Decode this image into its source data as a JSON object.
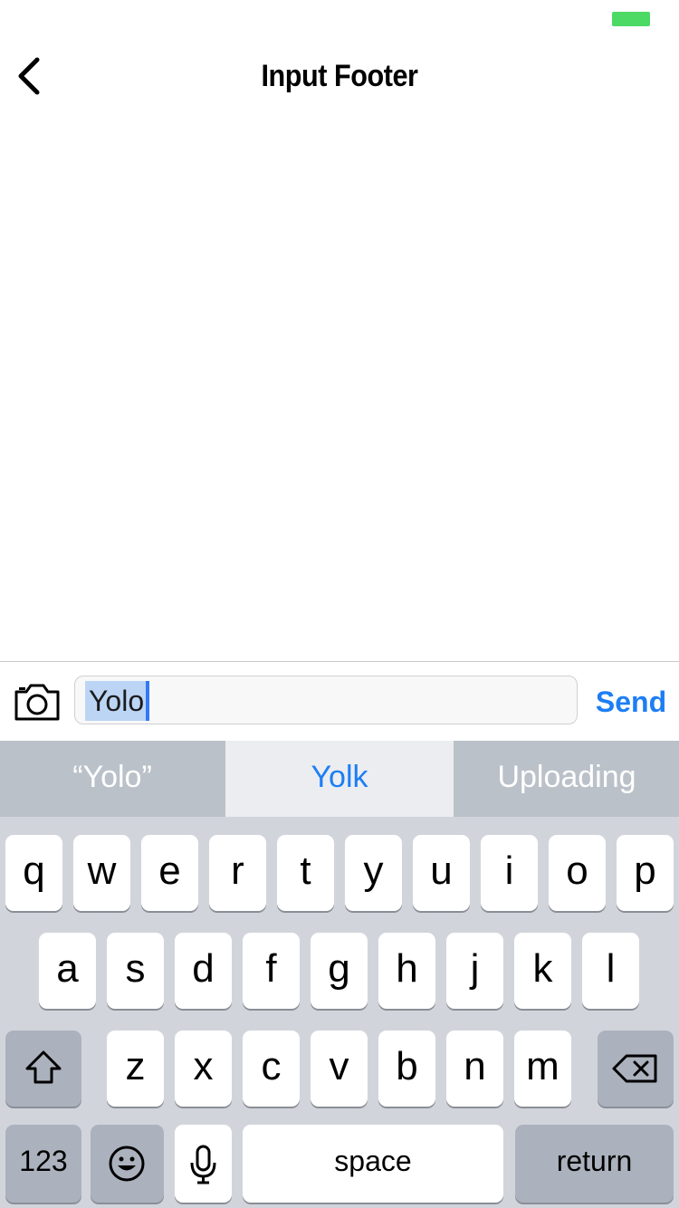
{
  "status_bar": {
    "battery_color": "#4cd964"
  },
  "nav": {
    "back_icon": "chevron-left-icon",
    "title": "Input Footer"
  },
  "footer": {
    "camera_icon": "camera-icon",
    "input_value": "Yolo",
    "send_label": "Send",
    "accent_color": "#1d7ef3"
  },
  "suggestions": [
    "“Yolo”",
    "Yolk",
    "Uploading"
  ],
  "keyboard": {
    "row1": [
      "q",
      "w",
      "e",
      "r",
      "t",
      "y",
      "u",
      "i",
      "o",
      "p"
    ],
    "row2": [
      "a",
      "s",
      "d",
      "f",
      "g",
      "h",
      "j",
      "k",
      "l"
    ],
    "row3": [
      "z",
      "x",
      "c",
      "v",
      "b",
      "n",
      "m"
    ],
    "shift_icon": "shift-icon",
    "delete_icon": "backspace-icon",
    "numbers_label": "123",
    "emoji_icon": "emoji-icon",
    "mic_icon": "microphone-icon",
    "space_label": "space",
    "return_label": "return"
  }
}
